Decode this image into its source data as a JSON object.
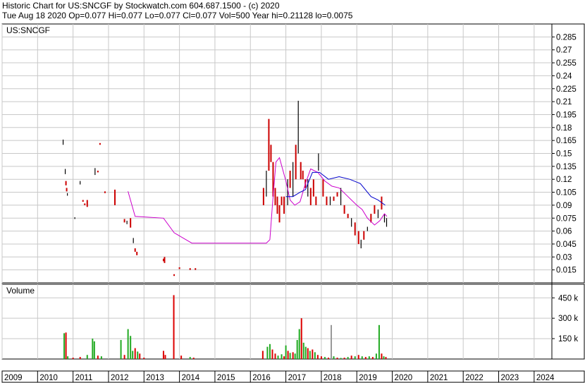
{
  "header": {
    "line1": "Historic Chart for US:SNCGF by Stockwatch.com 604.687.1500 - (c) 2020",
    "line2": "Tue Aug 18 2020  Op=0.077  Hi=0.077  Lo=0.077  Cl=0.077  Vol=500  Year hi=0.21128  lo=0.0075"
  },
  "colors": {
    "up_bar": "#cc0000",
    "down_bar": "#000000",
    "ma_short": "#cc00cc",
    "ma_long": "#0000cc",
    "vol_up": "#22aa22",
    "vol_down": "#dd0000",
    "vol_flat": "#999999",
    "grid": "#c8c8c8"
  },
  "chart_data": [
    {
      "type": "line",
      "title": "US:SNCGF",
      "xlabel": "",
      "ylabel": "",
      "xlim": [
        2009,
        2024.5
      ],
      "ylim": [
        0,
        0.3
      ],
      "y_ticks": [
        "0.285",
        "0.27",
        "0.255",
        "0.24",
        "0.225",
        "0.21",
        "0.195",
        "0.18",
        "0.165",
        "0.15",
        "0.135",
        "0.12",
        "0.105",
        "0.09",
        "0.075",
        "0.06",
        "0.045",
        "0.03",
        "0.015"
      ],
      "x_ticks": [
        "2009",
        "2010",
        "2011",
        "2012",
        "2013",
        "2014",
        "2015",
        "2016",
        "2017",
        "2018",
        "2019",
        "2020",
        "2021",
        "2022",
        "2023",
        "2024"
      ],
      "grid": true,
      "series": [
        {
          "style": "price-bars",
          "points": [
            [
              2010.72,
              0.16,
              0.166
            ],
            [
              2010.78,
              0.126,
              0.132
            ],
            [
              2010.8,
              0.113,
              0.118
            ],
            [
              2010.82,
              0.106,
              0.11
            ],
            [
              2010.84,
              0.101,
              0.104
            ],
            [
              2011.05,
              0.074,
              0.076
            ],
            [
              2011.2,
              0.114,
              0.118
            ],
            [
              2011.28,
              0.094,
              0.096
            ],
            [
              2011.33,
              0.09,
              0.092
            ],
            [
              2011.4,
              0.088,
              0.096
            ],
            [
              2011.62,
              0.125,
              0.133
            ],
            [
              2011.7,
              0.128,
              0.13
            ],
            [
              2011.76,
              0.16,
              0.162
            ],
            [
              2011.9,
              0.104,
              0.106
            ],
            [
              2012.18,
              0.09,
              0.108
            ],
            [
              2012.45,
              0.07,
              0.074
            ],
            [
              2012.52,
              0.068,
              0.072
            ],
            [
              2012.62,
              0.064,
              0.075
            ],
            [
              2012.7,
              0.046,
              0.052
            ],
            [
              2012.75,
              0.036,
              0.04
            ],
            [
              2012.8,
              0.032,
              0.036
            ],
            [
              2013.55,
              0.025,
              0.028
            ],
            [
              2013.58,
              0.023,
              0.03
            ],
            [
              2013.85,
              0.008,
              0.01
            ],
            [
              2014.0,
              0.016,
              0.018
            ],
            [
              2014.3,
              0.015,
              0.017
            ],
            [
              2014.45,
              0.015,
              0.017
            ],
            [
              2016.37,
              0.09,
              0.11
            ],
            [
              2016.45,
              0.1,
              0.13
            ],
            [
              2016.52,
              0.13,
              0.19
            ],
            [
              2016.58,
              0.14,
              0.16
            ],
            [
              2016.64,
              0.1,
              0.14
            ],
            [
              2016.7,
              0.09,
              0.11
            ],
            [
              2016.76,
              0.08,
              0.1
            ],
            [
              2016.82,
              0.07,
              0.09
            ],
            [
              2016.88,
              0.09,
              0.1
            ],
            [
              2016.95,
              0.08,
              0.1
            ],
            [
              2017.05,
              0.09,
              0.12
            ],
            [
              2017.12,
              0.11,
              0.13
            ],
            [
              2017.2,
              0.1,
              0.14
            ],
            [
              2017.28,
              0.12,
              0.16
            ],
            [
              2017.35,
              0.15,
              0.211
            ],
            [
              2017.42,
              0.12,
              0.14
            ],
            [
              2017.48,
              0.12,
              0.13
            ],
            [
              2017.55,
              0.11,
              0.12
            ],
            [
              2017.62,
              0.1,
              0.12
            ],
            [
              2017.7,
              0.09,
              0.11
            ],
            [
              2017.78,
              0.1,
              0.12
            ],
            [
              2017.85,
              0.09,
              0.1
            ],
            [
              2017.92,
              0.13,
              0.15
            ],
            [
              2018.05,
              0.1,
              0.12
            ],
            [
              2018.15,
              0.09,
              0.1
            ],
            [
              2018.25,
              0.09,
              0.1
            ],
            [
              2018.35,
              0.095,
              0.1
            ],
            [
              2018.45,
              0.1,
              0.105
            ],
            [
              2018.55,
              0.09,
              0.11
            ],
            [
              2018.65,
              0.08,
              0.09
            ],
            [
              2018.75,
              0.075,
              0.08
            ],
            [
              2018.85,
              0.065,
              0.075
            ],
            [
              2018.95,
              0.055,
              0.07
            ],
            [
              2019.05,
              0.045,
              0.06
            ],
            [
              2019.12,
              0.04,
              0.05
            ],
            [
              2019.2,
              0.05,
              0.06
            ],
            [
              2019.3,
              0.06,
              0.065
            ],
            [
              2019.4,
              0.07,
              0.08
            ],
            [
              2019.5,
              0.08,
              0.09
            ],
            [
              2019.6,
              0.075,
              0.085
            ],
            [
              2019.7,
              0.085,
              0.1
            ],
            [
              2019.78,
              0.07,
              0.08
            ],
            [
              2019.84,
              0.065,
              0.075
            ]
          ]
        },
        {
          "name": "moving-average-short",
          "x": [
            2010.0,
            2012.55,
            2012.75,
            2013.55,
            2013.85,
            2014.35,
            2016.45,
            2016.55,
            2016.62,
            2016.72,
            2016.82,
            2017.0,
            2017.12,
            2017.25,
            2017.4,
            2017.55,
            2017.7,
            2017.9,
            2018.1,
            2018.3,
            2018.5,
            2018.7,
            2018.85,
            2019.0,
            2019.15,
            2019.3,
            2019.5,
            2019.65,
            2019.78,
            2019.85
          ],
          "y": [
            null,
            0.106,
            0.077,
            0.075,
            0.058,
            0.046,
            0.046,
            0.05,
            0.09,
            0.14,
            0.145,
            0.118,
            0.096,
            0.09,
            0.094,
            0.115,
            0.132,
            0.128,
            0.118,
            0.112,
            0.11,
            0.102,
            0.096,
            0.09,
            0.085,
            0.075,
            0.067,
            0.072,
            0.08,
            0.077
          ]
        },
        {
          "name": "moving-average-long",
          "x": [
            2017.0,
            2017.2,
            2017.4,
            2017.55,
            2017.75,
            2017.95,
            2018.2,
            2018.5,
            2018.8,
            2019.1,
            2019.4,
            2019.6,
            2019.8
          ],
          "y": [
            0.1,
            0.1,
            0.105,
            0.108,
            0.128,
            0.128,
            0.12,
            0.123,
            0.12,
            0.115,
            0.1,
            0.096,
            0.09
          ]
        }
      ]
    },
    {
      "type": "bar",
      "title": "Volume",
      "ylim": [
        0,
        550000
      ],
      "y_ticks": [
        "450 k",
        "300 k",
        "150 k"
      ],
      "bars": [
        [
          2010.75,
          190000,
          "up"
        ],
        [
          2010.8,
          195000,
          "down"
        ],
        [
          2010.85,
          20000,
          "up"
        ],
        [
          2011.0,
          10000,
          "down"
        ],
        [
          2011.2,
          15000,
          "down"
        ],
        [
          2011.4,
          30000,
          "up"
        ],
        [
          2011.55,
          150000,
          "up"
        ],
        [
          2011.6,
          130000,
          "up"
        ],
        [
          2011.7,
          25000,
          "down"
        ],
        [
          2011.8,
          20000,
          "up"
        ],
        [
          2012.35,
          140000,
          "up"
        ],
        [
          2012.45,
          30000,
          "down"
        ],
        [
          2012.55,
          220000,
          "up"
        ],
        [
          2012.62,
          170000,
          "up"
        ],
        [
          2012.68,
          60000,
          "up"
        ],
        [
          2012.75,
          80000,
          "down"
        ],
        [
          2012.82,
          55000,
          "up"
        ],
        [
          2012.88,
          40000,
          "down"
        ],
        [
          2013.0,
          10000,
          "down"
        ],
        [
          2013.55,
          60000,
          "down"
        ],
        [
          2013.6,
          30000,
          "down"
        ],
        [
          2013.84,
          470000,
          "down"
        ],
        [
          2014.05,
          25000,
          "down"
        ],
        [
          2014.3,
          15000,
          "up"
        ],
        [
          2014.4,
          10000,
          "down"
        ],
        [
          2016.35,
          60000,
          "down"
        ],
        [
          2016.48,
          90000,
          "up"
        ],
        [
          2016.55,
          110000,
          "up"
        ],
        [
          2016.62,
          70000,
          "down"
        ],
        [
          2016.7,
          40000,
          "down"
        ],
        [
          2016.78,
          25000,
          "up"
        ],
        [
          2016.88,
          35000,
          "up"
        ],
        [
          2016.95,
          20000,
          "down"
        ],
        [
          2017.0,
          100000,
          "up"
        ],
        [
          2017.06,
          60000,
          "down"
        ],
        [
          2017.12,
          45000,
          "up"
        ],
        [
          2017.2,
          50000,
          "down"
        ],
        [
          2017.26,
          40000,
          "up"
        ],
        [
          2017.32,
          140000,
          "up"
        ],
        [
          2017.38,
          220000,
          "up"
        ],
        [
          2017.44,
          300000,
          "down"
        ],
        [
          2017.5,
          120000,
          "up"
        ],
        [
          2017.56,
          90000,
          "up"
        ],
        [
          2017.62,
          80000,
          "down"
        ],
        [
          2017.68,
          60000,
          "up"
        ],
        [
          2017.75,
          70000,
          "down"
        ],
        [
          2017.82,
          50000,
          "up"
        ],
        [
          2017.9,
          30000,
          "down"
        ],
        [
          2018.0,
          20000,
          "down"
        ],
        [
          2018.1,
          15000,
          "up"
        ],
        [
          2018.2,
          10000,
          "down"
        ],
        [
          2018.28,
          250000,
          "flat"
        ],
        [
          2018.35,
          20000,
          "up"
        ],
        [
          2018.45,
          10000,
          "down"
        ],
        [
          2018.55,
          8000,
          "up"
        ],
        [
          2018.65,
          10000,
          "down"
        ],
        [
          2018.75,
          15000,
          "up"
        ],
        [
          2018.85,
          25000,
          "down"
        ],
        [
          2018.95,
          20000,
          "up"
        ],
        [
          2019.05,
          30000,
          "down"
        ],
        [
          2019.15,
          20000,
          "up"
        ],
        [
          2019.25,
          15000,
          "down"
        ],
        [
          2019.35,
          20000,
          "up"
        ],
        [
          2019.45,
          15000,
          "down"
        ],
        [
          2019.55,
          40000,
          "up"
        ],
        [
          2019.63,
          250000,
          "up"
        ],
        [
          2019.7,
          40000,
          "down"
        ],
        [
          2019.76,
          20000,
          "up"
        ],
        [
          2019.82,
          15000,
          "down"
        ]
      ]
    }
  ]
}
